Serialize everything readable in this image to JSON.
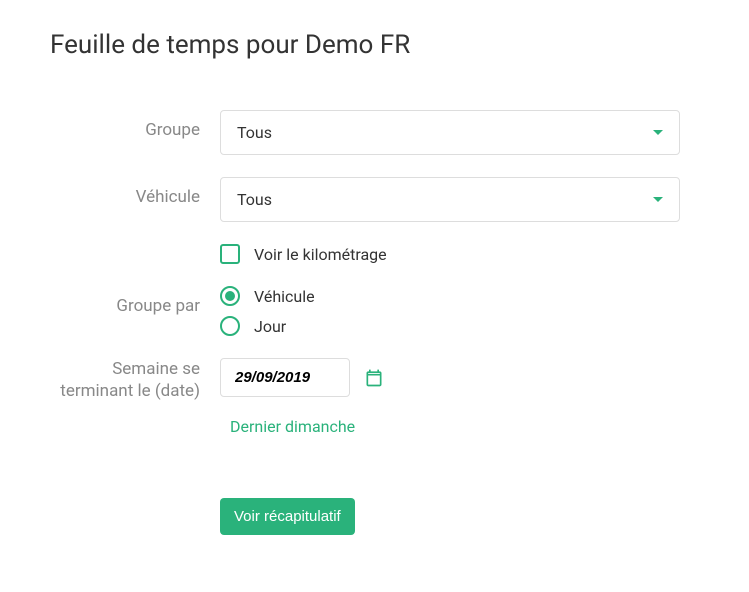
{
  "title": "Feuille de temps pour Demo FR",
  "form": {
    "group": {
      "label": "Groupe",
      "value": "Tous"
    },
    "vehicle": {
      "label": "Véhicule",
      "value": "Tous"
    },
    "mileage_checkbox": {
      "label": "Voir le kilométrage",
      "checked": false
    },
    "group_by": {
      "label": "Groupe par",
      "options": {
        "vehicle": "Véhicule",
        "day": "Jour"
      },
      "selected": "vehicle"
    },
    "week_ending": {
      "label": "Semaine se terminant le (date)",
      "value": "29/09/2019"
    },
    "last_sunday_link": "Dernier dimanche",
    "submit_button": "Voir récapitulatif"
  },
  "colors": {
    "accent": "#2ab27b"
  }
}
